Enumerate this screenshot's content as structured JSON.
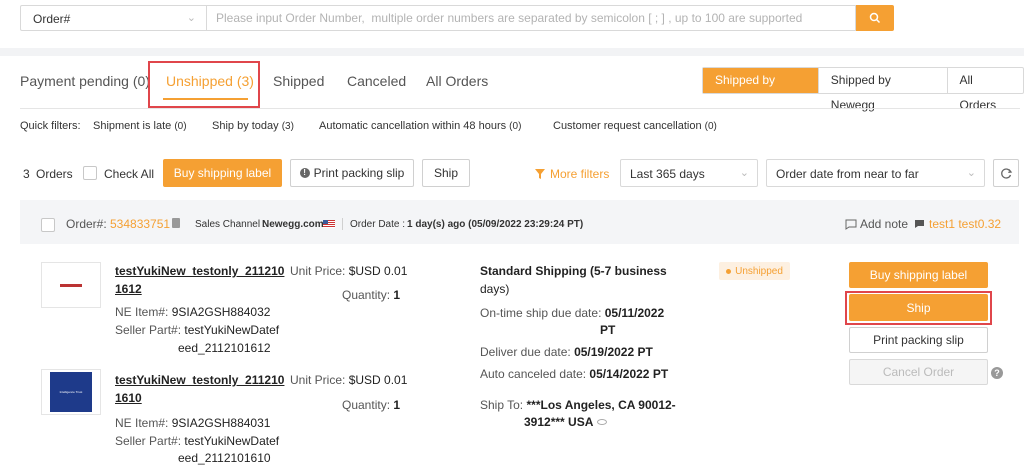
{
  "search": {
    "type_label": "Order#",
    "placeholder": "Please input Order Number,  multiple order numbers are separated by semicolon [ ; ] , up to 100 are supported"
  },
  "tabs": [
    {
      "label": "Payment pending (0)"
    },
    {
      "label": "Unshipped (3)"
    },
    {
      "label": "Shipped"
    },
    {
      "label": "Canceled"
    },
    {
      "label": "All Orders"
    }
  ],
  "segments": [
    "Shipped by Seller",
    "Shipped by Newegg",
    "All Orders"
  ],
  "quick_filters": {
    "label": "Quick filters:",
    "items": [
      {
        "label": "Shipment is late",
        "count": "(0)"
      },
      {
        "label": "Ship by today",
        "count": "(3)"
      },
      {
        "label": "Automatic cancellation within 48 hours",
        "count": "(0)"
      },
      {
        "label": "Customer request cancellation",
        "count": "(0)"
      }
    ]
  },
  "toolbar": {
    "order_count": "3",
    "orders_label": "Orders",
    "check_all": "Check All",
    "buy_label": "Buy shipping label",
    "print_label": "Print packing slip",
    "ship_label": "Ship",
    "more_filters": "More filters",
    "date_range": "Last 365 days",
    "sort": "Order date from near to far"
  },
  "order": {
    "order_prefix": "Order#:",
    "order_number": "534833751",
    "channel_label": "Sales Channel :",
    "channel_value": "Newegg.com",
    "date_label": "Order Date :",
    "date_value": "1 day(s) ago (05/09/2022 23:29:24 PT)",
    "add_note": "Add note",
    "note_user": "test1 test0.32",
    "items": [
      {
        "title_line1": "testYukiNew_testonly_211210",
        "title_line2": "1612",
        "ne_label": "NE Item#:",
        "ne_value": "9SIA2GSH884032",
        "seller_label": "Seller Part#:",
        "seller_line1": "testYukiNewDatef",
        "seller_line2": "eed_2112101612",
        "unit_price_label": "Unit Price:",
        "unit_price": "$USD 0.01",
        "qty_label": "Quantity:",
        "qty": "1",
        "thumb_text": ""
      },
      {
        "title_line1": "testYukiNew_testonly_211210",
        "title_line2": "1610",
        "ne_label": "NE Item#:",
        "ne_value": "9SIA2GSH884031",
        "seller_label": "Seller Part#:",
        "seller_line1": "testYukiNewDatef",
        "seller_line2": "eed_2112101610",
        "unit_price_label": "Unit Price:",
        "unit_price": "$USD 0.01",
        "qty_label": "Quantity:",
        "qty": "1",
        "thumb_text": "Intelligence Trust"
      }
    ],
    "shipping": {
      "method_line1": "Standard Shipping (5-7 business",
      "method_line2": "days)",
      "ontime_label": "On-time ship due date:",
      "ontime_value_line1": "05/11/2022",
      "ontime_value_line2": "PT",
      "deliver_label": "Deliver due date:",
      "deliver_value": "05/19/2022 PT",
      "auto_label": "Auto canceled date:",
      "auto_value": "05/14/2022 PT",
      "shipto_label": "Ship To:",
      "shipto_line1": "***Los Angeles, CA 90012-",
      "shipto_line2": "3912*** USA"
    },
    "status": "Unshipped",
    "actions": {
      "buy": "Buy shipping label",
      "ship": "Ship",
      "print": "Print packing slip",
      "cancel": "Cancel Order"
    }
  },
  "colors": {
    "accent": "#f5a033",
    "highlight": "#e0464b"
  }
}
